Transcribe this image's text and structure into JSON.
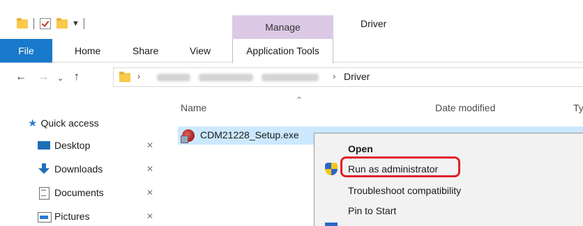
{
  "titlebar": {
    "manage_tab": "Manage",
    "window_title": "Driver"
  },
  "ribbon": {
    "tabs": [
      "File",
      "Home",
      "Share",
      "View"
    ],
    "context_tab": "Application Tools"
  },
  "address": {
    "current_folder": "Driver"
  },
  "navpane": {
    "quick_access": "Quick access",
    "items": [
      {
        "label": "Desktop",
        "icon": "desktop-icon",
        "pinned": true
      },
      {
        "label": "Downloads",
        "icon": "downloads-icon",
        "pinned": true
      },
      {
        "label": "Documents",
        "icon": "documents-icon",
        "pinned": true
      },
      {
        "label": "Pictures",
        "icon": "pictures-icon",
        "pinned": true
      }
    ]
  },
  "columns": {
    "name": "Name",
    "date_modified": "Date modified",
    "type": "Ty"
  },
  "file": {
    "name": "CDM21228_Setup.exe",
    "selected": true
  },
  "context_menu": {
    "items": [
      {
        "label": "Open",
        "bold": true
      },
      {
        "label": "Run as administrator",
        "highlighted": true,
        "icon": "uac-shield-icon"
      },
      {
        "label": "Troubleshoot compatibility"
      },
      {
        "label": "Pin to Start"
      }
    ],
    "highlight_color": "#e0202a"
  },
  "colors": {
    "file_tab": "#1979ca",
    "manage_tab": "#dcc9e6",
    "selection": "#cce8ff"
  }
}
